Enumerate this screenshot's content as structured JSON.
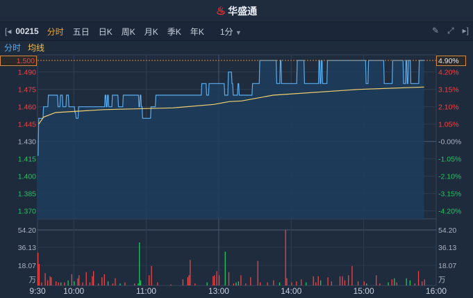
{
  "header": {
    "app_name": "华盛通"
  },
  "toolbar": {
    "code": "00215",
    "tabs": [
      "分时",
      "五日",
      "日K",
      "周K",
      "月K",
      "季K",
      "年K"
    ],
    "active_tab": "分时",
    "interval": "1分"
  },
  "legend": {
    "line": "分时",
    "avg": "均线"
  },
  "colors": {
    "up": "#ef4444",
    "down": "#22c55e",
    "neutral": "#aab4c2",
    "price_line": "#5aaef0",
    "avg_line": "#f3d36b",
    "accent": "#f0a830"
  },
  "chart_data": {
    "type": "line",
    "prev_close": 1.43,
    "price_ticks": [
      "1.500",
      "1.490",
      "1.475",
      "1.460",
      "1.445",
      "1.430",
      "1.415",
      "1.400",
      "1.385",
      "1.370"
    ],
    "pct_ticks": [
      "4.90%",
      "4.20%",
      "3.15%",
      "2.10%",
      "1.05%",
      "-0.00%",
      "-1.05%",
      "-2.10%",
      "-3.15%",
      "-4.20%"
    ],
    "price_range": [
      1.365,
      1.5
    ],
    "volume_ticks": [
      "54.20",
      "36.13",
      "18.07"
    ],
    "volume_unit": "万",
    "volume_max": 54.2,
    "time_labels": [
      "9:30",
      "10:00",
      "11:00",
      "13:00",
      "14:00",
      "15:00",
      "16:00"
    ],
    "time_minutes": [
      0,
      30,
      90,
      150,
      210,
      270,
      330
    ],
    "price_steps": [
      [
        0,
        1.418
      ],
      [
        1,
        1.45
      ],
      [
        5,
        1.46
      ],
      [
        9,
        1.47
      ],
      [
        17,
        1.46
      ],
      [
        19,
        1.47
      ],
      [
        21,
        1.46
      ],
      [
        24,
        1.47
      ],
      [
        26,
        1.46
      ],
      [
        31,
        1.455
      ],
      [
        32,
        1.45
      ],
      [
        34,
        1.46
      ],
      [
        56,
        1.47
      ],
      [
        57,
        1.46
      ],
      [
        58,
        1.47
      ],
      [
        59,
        1.46
      ],
      [
        62,
        1.47
      ],
      [
        67,
        1.46
      ],
      [
        71,
        1.47
      ],
      [
        84,
        1.46
      ],
      [
        85,
        1.47
      ],
      [
        86,
        1.46
      ],
      [
        87,
        1.45
      ],
      [
        94,
        1.46
      ],
      [
        98,
        1.47
      ],
      [
        136,
        1.48
      ],
      [
        140,
        1.47
      ],
      [
        142,
        1.48
      ],
      [
        155,
        1.47
      ],
      [
        158,
        1.49
      ],
      [
        161,
        1.48
      ],
      [
        162,
        1.47
      ],
      [
        166,
        1.48
      ],
      [
        167,
        1.47
      ],
      [
        178,
        1.48
      ],
      [
        184,
        1.5
      ],
      [
        198,
        1.48
      ],
      [
        201,
        1.5
      ],
      [
        202,
        1.48
      ],
      [
        215,
        1.5
      ],
      [
        221,
        1.48
      ],
      [
        233,
        1.5
      ],
      [
        234,
        1.48
      ],
      [
        235,
        1.5
      ],
      [
        236,
        1.48
      ],
      [
        240,
        1.5
      ],
      [
        272,
        1.48
      ],
      [
        274,
        1.5
      ],
      [
        287,
        1.48
      ],
      [
        294,
        1.5
      ],
      [
        303,
        1.48
      ],
      [
        305,
        1.5
      ],
      [
        306,
        1.48
      ],
      [
        307,
        1.5
      ],
      [
        309,
        1.48
      ],
      [
        316,
        1.5
      ],
      [
        320,
        1.5
      ]
    ],
    "avg_points": [
      [
        1,
        1.445
      ],
      [
        5,
        1.451
      ],
      [
        15,
        1.455
      ],
      [
        55,
        1.4575
      ],
      [
        112,
        1.459
      ],
      [
        146,
        1.462
      ],
      [
        159,
        1.4645
      ],
      [
        169,
        1.465
      ],
      [
        195,
        1.47
      ],
      [
        266,
        1.475
      ],
      [
        320,
        1.477
      ]
    ],
    "volume_bars": [
      [
        0,
        32,
        "up"
      ],
      [
        1,
        21,
        "up"
      ],
      [
        3,
        3,
        "up"
      ],
      [
        6,
        12,
        "up"
      ],
      [
        8,
        5,
        "up"
      ],
      [
        10,
        9,
        "up"
      ],
      [
        11,
        8,
        "up"
      ],
      [
        15,
        4,
        "up"
      ],
      [
        17,
        3,
        "up"
      ],
      [
        19,
        3,
        "down"
      ],
      [
        22,
        3,
        "up"
      ],
      [
        25,
        5,
        "down"
      ],
      [
        28,
        11,
        "up"
      ],
      [
        30,
        4,
        "down"
      ],
      [
        33,
        7,
        "up"
      ],
      [
        34,
        10,
        "up"
      ],
      [
        37,
        3,
        "up"
      ],
      [
        40,
        13,
        "up"
      ],
      [
        43,
        3,
        "up"
      ],
      [
        45,
        9,
        "up"
      ],
      [
        46,
        14,
        "up"
      ],
      [
        50,
        2,
        "up"
      ],
      [
        53,
        8,
        "up"
      ],
      [
        55,
        11,
        "up"
      ],
      [
        58,
        4,
        "down"
      ],
      [
        62,
        2,
        "up"
      ],
      [
        64,
        7,
        "up"
      ],
      [
        68,
        2,
        "down"
      ],
      [
        72,
        3,
        "up"
      ],
      [
        80,
        2,
        "up"
      ],
      [
        83,
        2,
        "down"
      ],
      [
        84,
        42,
        "down"
      ],
      [
        85,
        5,
        "down"
      ],
      [
        92,
        10,
        "up"
      ],
      [
        94,
        19,
        "up"
      ],
      [
        99,
        3,
        "up"
      ],
      [
        110,
        1,
        "up"
      ],
      [
        120,
        6,
        "up"
      ],
      [
        124,
        8,
        "up"
      ],
      [
        125,
        10,
        "up"
      ],
      [
        126,
        25,
        "up"
      ],
      [
        130,
        2,
        "up"
      ],
      [
        140,
        3,
        "down"
      ],
      [
        145,
        9,
        "up"
      ],
      [
        146,
        10,
        "up"
      ],
      [
        148,
        14,
        "up"
      ],
      [
        150,
        10,
        "up"
      ],
      [
        155,
        33,
        "down"
      ],
      [
        158,
        13,
        "up"
      ],
      [
        162,
        2,
        "up"
      ],
      [
        164,
        3,
        "down"
      ],
      [
        166,
        4,
        "down"
      ],
      [
        168,
        10,
        "up"
      ],
      [
        172,
        2,
        "up"
      ],
      [
        176,
        8,
        "up"
      ],
      [
        182,
        24,
        "up"
      ],
      [
        184,
        3,
        "up"
      ],
      [
        190,
        3,
        "up"
      ],
      [
        195,
        5,
        "up"
      ],
      [
        200,
        3,
        "down"
      ],
      [
        205,
        54.2,
        "up"
      ],
      [
        206,
        7,
        "up"
      ],
      [
        210,
        3,
        "up"
      ],
      [
        214,
        4,
        "up"
      ],
      [
        218,
        6,
        "up"
      ],
      [
        222,
        3,
        "down"
      ],
      [
        228,
        9,
        "up"
      ],
      [
        230,
        3,
        "up"
      ],
      [
        232,
        9,
        "up"
      ],
      [
        234,
        5,
        "down"
      ],
      [
        240,
        8,
        "up"
      ],
      [
        243,
        4,
        "up"
      ],
      [
        250,
        9,
        "up"
      ],
      [
        252,
        9,
        "up"
      ],
      [
        254,
        5,
        "up"
      ],
      [
        257,
        10,
        "up"
      ],
      [
        260,
        19,
        "up"
      ],
      [
        265,
        4,
        "up"
      ],
      [
        270,
        4,
        "up"
      ],
      [
        272,
        2,
        "down"
      ],
      [
        280,
        10,
        "up"
      ],
      [
        283,
        2,
        "up"
      ],
      [
        290,
        3,
        "down"
      ],
      [
        293,
        6,
        "up"
      ],
      [
        295,
        7,
        "down"
      ],
      [
        297,
        3,
        "up"
      ],
      [
        305,
        7,
        "down"
      ],
      [
        308,
        5,
        "down"
      ],
      [
        312,
        2,
        "up"
      ],
      [
        315,
        14,
        "up"
      ],
      [
        318,
        4,
        "up"
      ],
      [
        320,
        6,
        "up"
      ]
    ]
  }
}
